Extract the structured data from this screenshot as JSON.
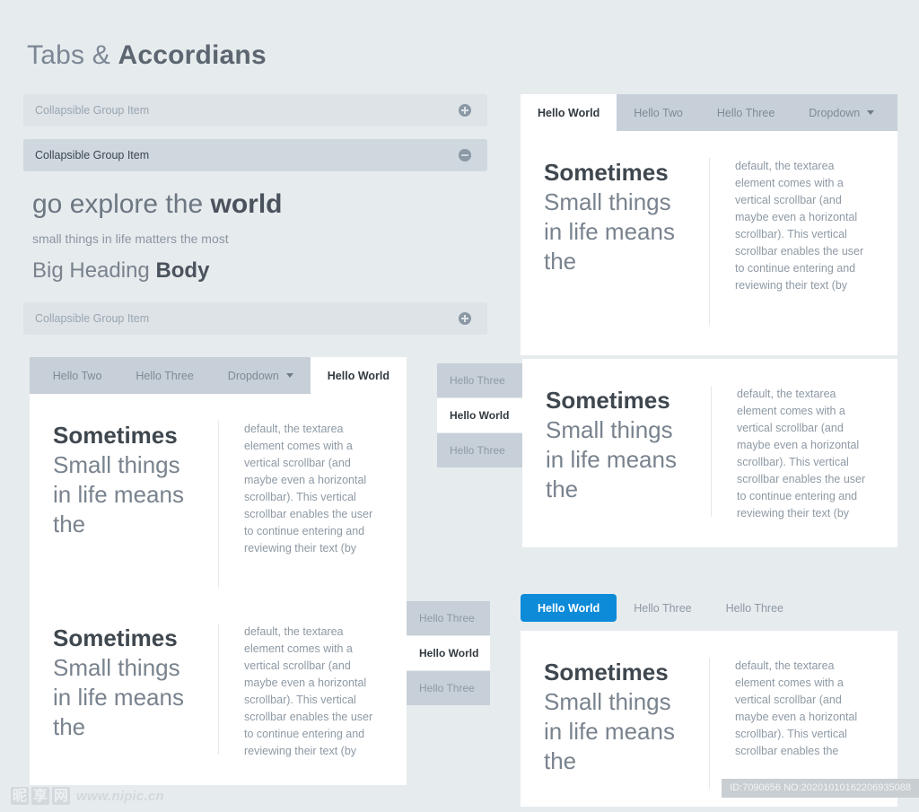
{
  "page": {
    "title_light": "Tabs & ",
    "title_bold": "Accordians"
  },
  "accordion": {
    "items": [
      {
        "label": "Collapsible Group Item",
        "icon": "plus-circle-icon",
        "state": "collapsed"
      },
      {
        "label": "Collapsible Group Item",
        "icon": "minus-circle-icon",
        "state": "expanded"
      },
      {
        "label": "Collapsible Group Item",
        "icon": "plus-circle-icon",
        "state": "collapsed"
      }
    ],
    "body": {
      "heading_light": "go explore the ",
      "heading_bold": "world",
      "subtext": "small things in life matters the most",
      "heading2_light": "Big Heading ",
      "heading2_bold": "Body"
    }
  },
  "content": {
    "lede_bold": "Sometimes",
    "lede_rest": "Small things in life means the",
    "paragraph": "default, the textarea element comes with a vertical scrollbar (and maybe even a horizontal scrollbar). This vertical scrollbar enables the user to continue entering and reviewing their text (by",
    "paragraph_short": "default, the textarea element comes with a vertical scrollbar (and maybe even a horizontal scrollbar). This vertical scrollbar enables the"
  },
  "panel_top_right": {
    "tabs": [
      {
        "label": "Hello World",
        "active": true
      },
      {
        "label": "Hello Two",
        "active": false
      },
      {
        "label": "Hello Three",
        "active": false
      },
      {
        "label": "Dropdown",
        "active": false,
        "caret": "chevron-down-icon"
      }
    ]
  },
  "panel_mid_left": {
    "tabs": [
      {
        "label": "Hello Two",
        "active": false
      },
      {
        "label": "Hello Three",
        "active": false
      },
      {
        "label": "Dropdown",
        "active": false,
        "caret": "chevron-down-icon"
      },
      {
        "label": "Hello World",
        "active": true
      }
    ]
  },
  "panel_mid_right": {
    "tabs": [
      {
        "label": "Hello Three",
        "active": false
      },
      {
        "label": "Hello World",
        "active": true
      },
      {
        "label": "Hello Three",
        "active": false
      }
    ]
  },
  "panel_bot_left": {
    "tabs": [
      {
        "label": "Hello Three",
        "active": false
      },
      {
        "label": "Hello World",
        "active": true
      },
      {
        "label": "Hello Three",
        "active": false
      }
    ]
  },
  "panel_bot_right": {
    "tabs": [
      {
        "label": "Hello World",
        "active": true
      },
      {
        "label": "Hello Three",
        "active": false
      },
      {
        "label": "Hello Three",
        "active": false
      }
    ]
  },
  "footer": {
    "watermark_cjk": [
      "昵",
      "享",
      "网"
    ],
    "watermark_url": "www.nipic.cn",
    "id_text": "ID:7090656 NO:20201010162206935088"
  },
  "colors": {
    "page_background": "#e6ebee",
    "tabbar": "#c7d0d8",
    "accordion_inactive": "#dde3e7",
    "accordion_active": "#cfd8de",
    "accent_blue": "#0d8bd9",
    "panel_white": "#ffffff"
  }
}
